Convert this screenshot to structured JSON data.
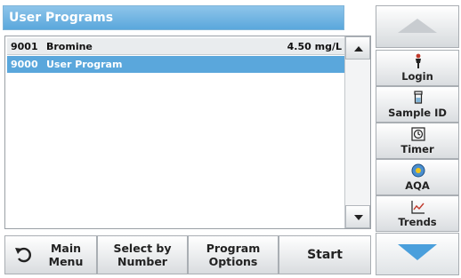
{
  "title": "User Programs",
  "programs": [
    {
      "code": "9001",
      "name": "Bromine",
      "concentration": "4.50 mg/L"
    },
    {
      "code": "9000",
      "name": "User Program",
      "concentration": ""
    }
  ],
  "selected_index": 1,
  "bottom": {
    "main_menu": [
      "Main",
      "Menu"
    ],
    "select_by_number": [
      "Select by",
      "Number"
    ],
    "program_options": [
      "Program",
      "Options"
    ],
    "start": "Start"
  },
  "side": {
    "login": "Login",
    "sample_id": "Sample ID",
    "timer": "Timer",
    "aqa": "AQA",
    "trends": "Trends"
  },
  "colors": {
    "accent": "#5aa7dc",
    "nav_down": "#4a9fdc"
  }
}
